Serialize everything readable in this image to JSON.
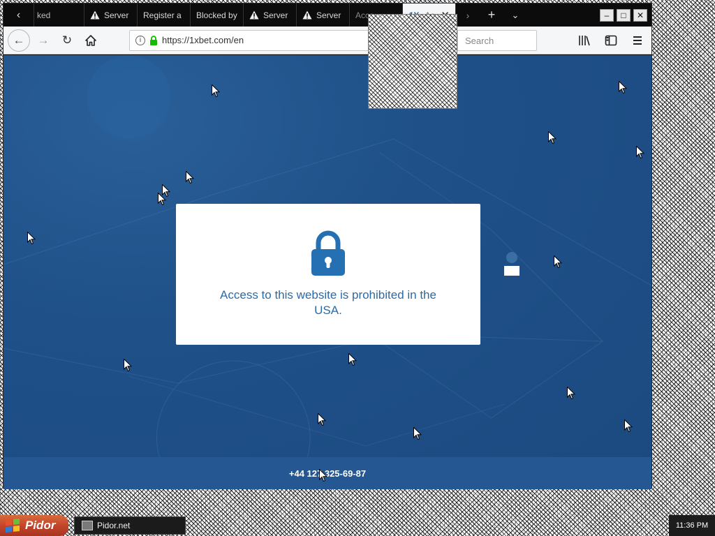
{
  "browser": {
    "tabs": [
      {
        "label": "ked",
        "icon": "none",
        "style": "first"
      },
      {
        "label": "Server",
        "icon": "warning-icon",
        "style": "normal"
      },
      {
        "label": "Register a",
        "icon": "none",
        "style": "normal"
      },
      {
        "label": "Blocked by",
        "icon": "none",
        "style": "normal"
      },
      {
        "label": "Server",
        "icon": "warning-icon",
        "style": "normal"
      },
      {
        "label": "Server",
        "icon": "warning-icon",
        "style": "normal"
      },
      {
        "label": "Acce",
        "icon": "none",
        "style": "dim"
      }
    ],
    "active_tab": {
      "brand": "1X",
      "label": "Ac",
      "close": "✕"
    },
    "url": "https://1xbet.com/en",
    "search_placeholder": "Search"
  },
  "page": {
    "message": "Access to this website is prohibited in the USA.",
    "footer_phone": "+44 127 325-69-87"
  },
  "taskbar": {
    "start_label": "Pidor",
    "task_label": "Pidor.net",
    "clock": "11:36 PM"
  },
  "colors": {
    "page_bg": "#1f5088",
    "footer_bg": "#255892",
    "message_text": "#2b6aa6",
    "brand": "#1d5fa8"
  }
}
